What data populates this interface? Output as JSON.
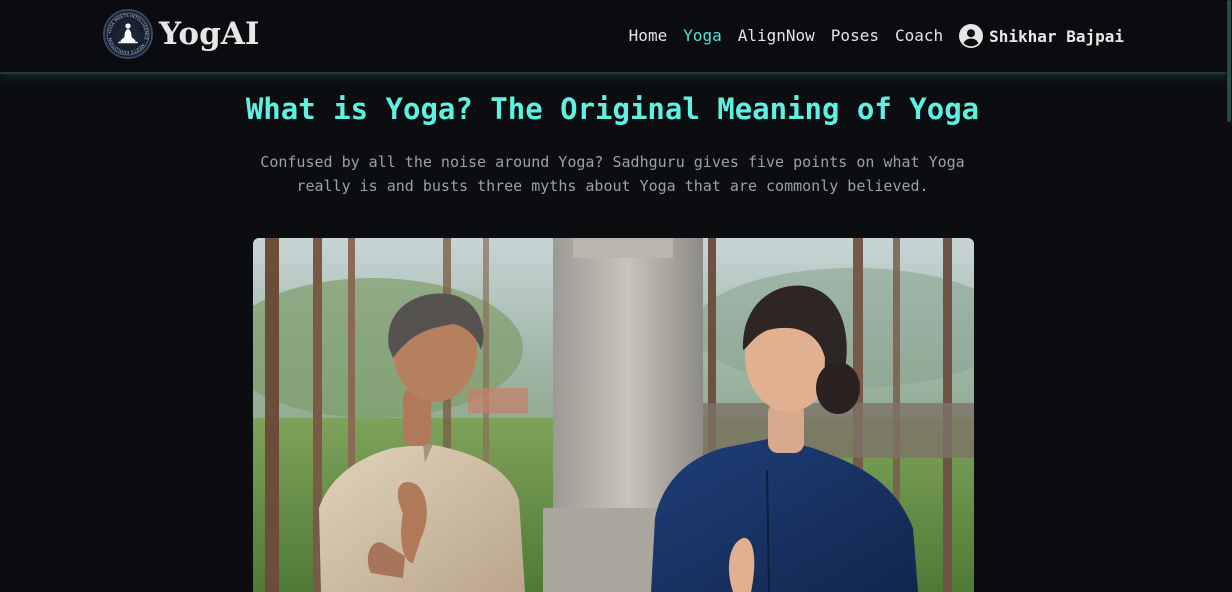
{
  "brand": {
    "name": "YogAI",
    "logo_ring_text": "YOGA MEETS INTELLIGENCE · MEETS EVOLUTION ·"
  },
  "nav": {
    "items": [
      {
        "label": "Home",
        "active": false
      },
      {
        "label": "Yoga",
        "active": true
      },
      {
        "label": "AlignNow",
        "active": false
      },
      {
        "label": "Poses",
        "active": false
      },
      {
        "label": "Coach",
        "active": false
      }
    ],
    "user_name": "Shikhar Bajpai"
  },
  "article": {
    "title": "What is Yoga? The Original Meaning of Yoga",
    "subtitle": "Confused by all the noise around Yoga? Sadhguru gives five points on what Yoga really is and busts three myths about Yoga that are commonly believed."
  },
  "colors": {
    "background": "#0b0d10",
    "accent": "#5ef2e3",
    "active_link": "#4fe3d6",
    "muted_text": "#9aa0a6"
  }
}
